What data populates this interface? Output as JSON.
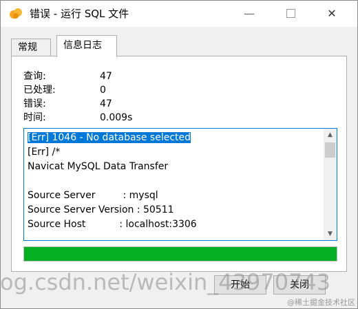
{
  "window": {
    "title": "错误 - 运行 SQL 文件",
    "controls": {
      "minimize": "—",
      "close": "✕"
    }
  },
  "tabs": [
    {
      "label": "常规",
      "active": false
    },
    {
      "label": "信息日志",
      "active": true
    }
  ],
  "stats": [
    {
      "label": "查询:",
      "value": "47"
    },
    {
      "label": "已处理:",
      "value": "0"
    },
    {
      "label": "错误:",
      "value": "47"
    },
    {
      "label": "时间:",
      "value": "0.009s"
    }
  ],
  "log": {
    "lines": [
      "[Err] 1046 - No database selected",
      "[Err] /*",
      "Navicat MySQL Data Transfer",
      "",
      "Source Server         : mysql",
      "Source Server Version : 50511",
      "Source Host           : localhost:3306"
    ],
    "selected_line": 0
  },
  "progress": {
    "fraction": 1.0,
    "color": "#06b025"
  },
  "buttons": {
    "start": "开始",
    "close": "关闭"
  },
  "watermark": {
    "text": "og.csdn.net/weixin_43970743",
    "corner": "@稀土掘金技术社区"
  }
}
